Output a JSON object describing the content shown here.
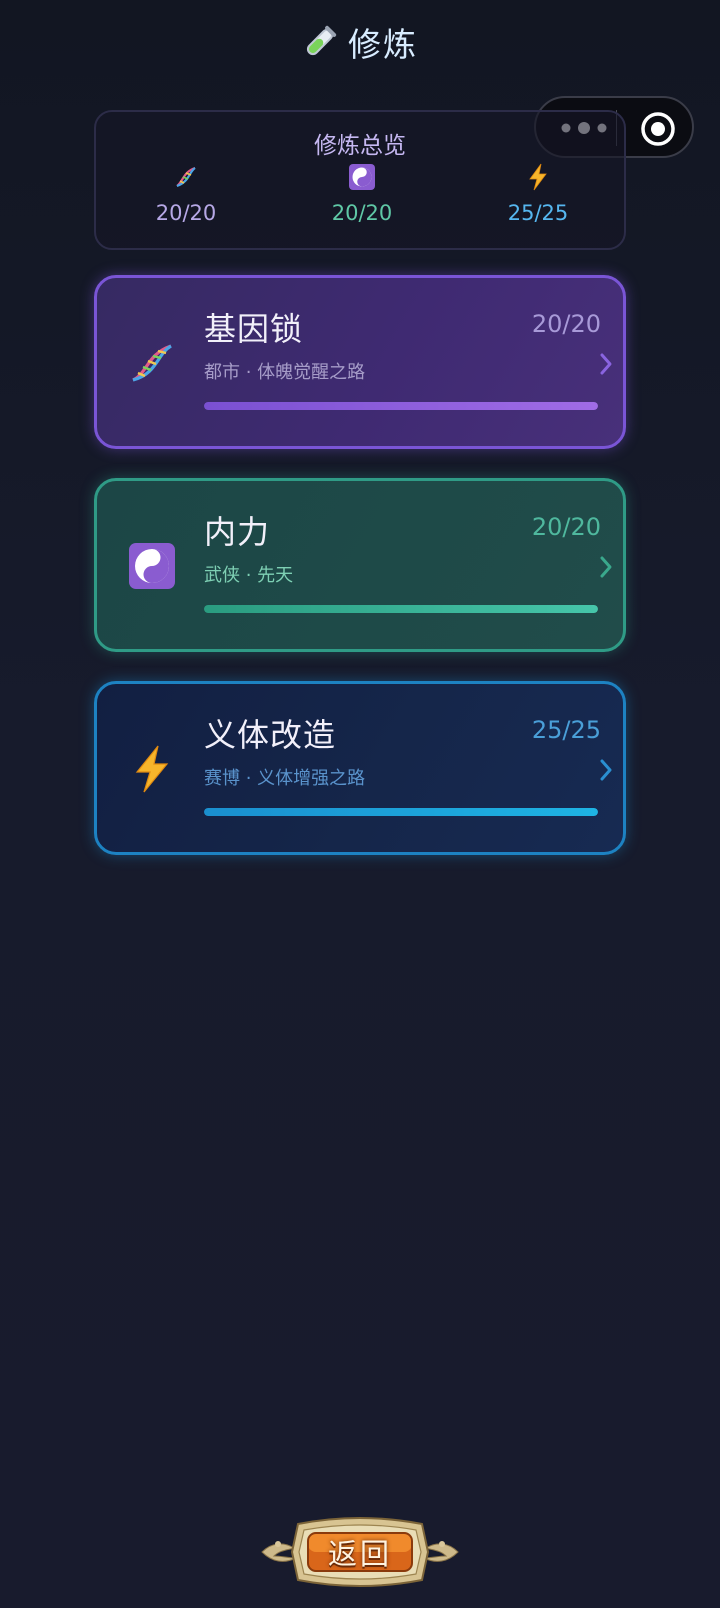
{
  "header": {
    "title": "修炼",
    "icon": "test-tube-icon"
  },
  "capsule": {
    "more_icon": "more-dots-icon",
    "close_icon": "target-circle-icon"
  },
  "overview": {
    "title": "修炼总览",
    "stats": [
      {
        "icon": "dna-icon",
        "value": "20/20",
        "color": "#b6a8e6"
      },
      {
        "icon": "yin-yang-icon",
        "value": "20/20",
        "color": "#5fc8a6"
      },
      {
        "icon": "lightning-icon",
        "value": "25/25",
        "color": "#56b7f0"
      }
    ]
  },
  "cards": [
    {
      "name": "基因锁",
      "count": "20/20",
      "subtitle": "都市 · 体魄觉醒之路",
      "icon": "dna-icon",
      "progress": 1.0,
      "accent": "#7a55d6"
    },
    {
      "name": "内力",
      "count": "20/20",
      "subtitle": "武侠 · 先天",
      "icon": "yin-yang-icon",
      "progress": 1.0,
      "accent": "#2f9b86"
    },
    {
      "name": "义体改造",
      "count": "25/25",
      "subtitle": "赛博 · 义体增强之路",
      "icon": "lightning-icon",
      "progress": 1.0,
      "accent": "#1d82c2"
    }
  ],
  "footer": {
    "back_label": "返回"
  }
}
